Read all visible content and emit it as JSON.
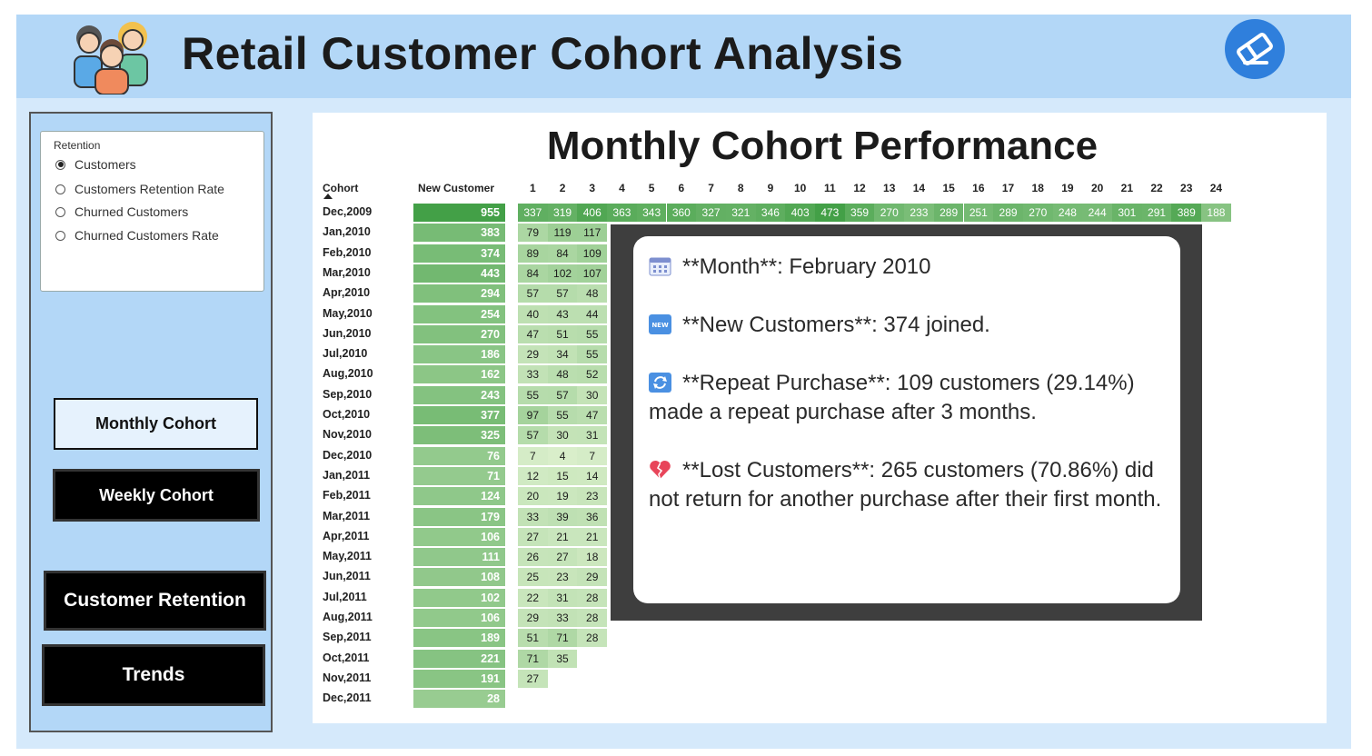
{
  "header": {
    "title": "Retail Customer Cohort Analysis"
  },
  "icons": {
    "logo": "people-group-icon",
    "eraser": "eraser-icon"
  },
  "sidebar": {
    "radio_title": "Retention",
    "radio_options": [
      "Customers",
      "Customers Retention Rate",
      "Churned Customers",
      "Churned Customers Rate"
    ],
    "selected_index": 0,
    "buttons": [
      "Monthly Cohort",
      "Weekly Cohort",
      "Customer Retention",
      "Trends"
    ]
  },
  "main": {
    "title": "Monthly Cohort Performance",
    "col_cohort": "Cohort",
    "col_new": "New Customer",
    "month_headers": [
      "1",
      "2",
      "3",
      "4",
      "5",
      "6",
      "7",
      "8",
      "9",
      "10",
      "11",
      "12",
      "13",
      "14",
      "15",
      "16",
      "17",
      "18",
      "19",
      "20",
      "21",
      "22",
      "23",
      "24"
    ],
    "rows": [
      {
        "cohort": "Dec,2009",
        "new": "955",
        "v": [
          "337",
          "319",
          "406",
          "363",
          "343",
          "360",
          "327",
          "321",
          "346",
          "403",
          "473",
          "359",
          "270",
          "233",
          "289",
          "251",
          "289",
          "270",
          "248",
          "244",
          "301",
          "291",
          "389",
          "188"
        ]
      },
      {
        "cohort": "Jan,2010",
        "new": "383",
        "v": [
          "79",
          "119",
          "117"
        ]
      },
      {
        "cohort": "Feb,2010",
        "new": "374",
        "v": [
          "89",
          "84",
          "109"
        ]
      },
      {
        "cohort": "Mar,2010",
        "new": "443",
        "v": [
          "84",
          "102",
          "107"
        ]
      },
      {
        "cohort": "Apr,2010",
        "new": "294",
        "v": [
          "57",
          "57",
          "48"
        ]
      },
      {
        "cohort": "May,2010",
        "new": "254",
        "v": [
          "40",
          "43",
          "44"
        ]
      },
      {
        "cohort": "Jun,2010",
        "new": "270",
        "v": [
          "47",
          "51",
          "55"
        ]
      },
      {
        "cohort": "Jul,2010",
        "new": "186",
        "v": [
          "29",
          "34",
          "55"
        ]
      },
      {
        "cohort": "Aug,2010",
        "new": "162",
        "v": [
          "33",
          "48",
          "52"
        ]
      },
      {
        "cohort": "Sep,2010",
        "new": "243",
        "v": [
          "55",
          "57",
          "30"
        ]
      },
      {
        "cohort": "Oct,2010",
        "new": "377",
        "v": [
          "97",
          "55",
          "47"
        ]
      },
      {
        "cohort": "Nov,2010",
        "new": "325",
        "v": [
          "57",
          "30",
          "31"
        ]
      },
      {
        "cohort": "Dec,2010",
        "new": "76",
        "v": [
          "7",
          "4",
          "7"
        ]
      },
      {
        "cohort": "Jan,2011",
        "new": "71",
        "v": [
          "12",
          "15",
          "14"
        ]
      },
      {
        "cohort": "Feb,2011",
        "new": "124",
        "v": [
          "20",
          "19",
          "23"
        ]
      },
      {
        "cohort": "Mar,2011",
        "new": "179",
        "v": [
          "33",
          "39",
          "36"
        ]
      },
      {
        "cohort": "Apr,2011",
        "new": "106",
        "v": [
          "27",
          "21",
          "21"
        ]
      },
      {
        "cohort": "May,2011",
        "new": "111",
        "v": [
          "26",
          "27",
          "18"
        ]
      },
      {
        "cohort": "Jun,2011",
        "new": "108",
        "v": [
          "25",
          "23",
          "29"
        ]
      },
      {
        "cohort": "Jul,2011",
        "new": "102",
        "v": [
          "22",
          "31",
          "28"
        ]
      },
      {
        "cohort": "Aug,2011",
        "new": "106",
        "v": [
          "29",
          "33",
          "28"
        ]
      },
      {
        "cohort": "Sep,2011",
        "new": "189",
        "v": [
          "51",
          "71",
          "28"
        ]
      },
      {
        "cohort": "Oct,2011",
        "new": "221",
        "v": [
          "71",
          "35"
        ]
      },
      {
        "cohort": "Nov,2011",
        "new": "191",
        "v": [
          "27"
        ]
      },
      {
        "cohort": "Dec,2011",
        "new": "28",
        "v": []
      }
    ]
  },
  "tooltip": {
    "month": "**Month**: February 2010",
    "new_customers": "**New Customers**: 374 joined.",
    "repeat": "**Repeat Purchase**: 109 customers (29.14%) made a repeat purchase after 3 months.",
    "lost": "**Lost Customers**: 265 customers (70.86%) did not return for another purchase after their first month.",
    "icons": [
      "calendar-icon",
      "new-badge-icon",
      "repeat-arrows-icon",
      "broken-heart-icon"
    ]
  },
  "colors": {
    "header_bg": "#b3d7f7",
    "heat_dark": "#43a047",
    "heat_light": "#e6f5d6",
    "button_dark": "#000000",
    "button_light": "#e6f2fd"
  }
}
